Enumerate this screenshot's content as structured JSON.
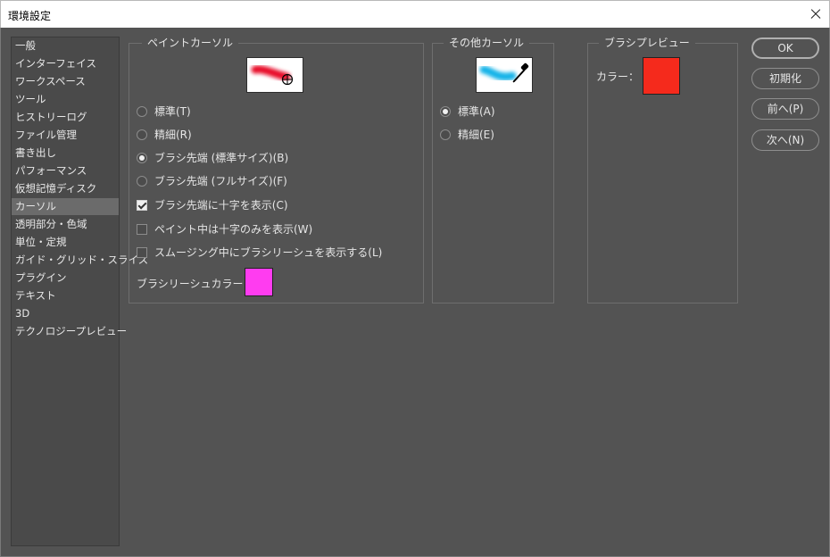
{
  "window": {
    "title": "環境設定"
  },
  "sidebar": {
    "items": [
      {
        "label": "一般",
        "selected": false
      },
      {
        "label": "インターフェイス",
        "selected": false
      },
      {
        "label": "ワークスペース",
        "selected": false
      },
      {
        "label": "ツール",
        "selected": false
      },
      {
        "label": "ヒストリーログ",
        "selected": false
      },
      {
        "label": "ファイル管理",
        "selected": false
      },
      {
        "label": "書き出し",
        "selected": false
      },
      {
        "label": "パフォーマンス",
        "selected": false
      },
      {
        "label": "仮想記憶ディスク",
        "selected": false
      },
      {
        "label": "カーソル",
        "selected": true
      },
      {
        "label": "透明部分・色域",
        "selected": false
      },
      {
        "label": "単位・定規",
        "selected": false
      },
      {
        "label": "ガイド・グリッド・スライス",
        "selected": false
      },
      {
        "label": "プラグイン",
        "selected": false
      },
      {
        "label": "テキスト",
        "selected": false
      },
      {
        "label": "3D",
        "selected": false
      },
      {
        "label": "テクノロジープレビュー",
        "selected": false
      }
    ]
  },
  "paint_cursor": {
    "legend": "ペイントカーソル",
    "options": [
      {
        "label": "標準(T)",
        "type": "radio",
        "checked": false
      },
      {
        "label": "精細(R)",
        "type": "radio",
        "checked": false
      },
      {
        "label": "ブラシ先端 (標準サイズ)(B)",
        "type": "radio",
        "checked": true
      },
      {
        "label": "ブラシ先端 (フルサイズ)(F)",
        "type": "radio",
        "checked": false
      },
      {
        "label": "ブラシ先端に十字を表示(C)",
        "type": "check",
        "checked": true
      },
      {
        "label": "ペイント中は十字のみを表示(W)",
        "type": "check",
        "checked": false
      },
      {
        "label": "スムージング中にブラシリーシュを表示する(L)",
        "type": "check",
        "checked": false
      }
    ],
    "leash_color_label": "ブラシリーシュカラー：",
    "leash_color": "#ff3cf0",
    "preview_stroke_color": "#e8102a"
  },
  "other_cursor": {
    "legend": "その他カーソル",
    "options": [
      {
        "label": "標準(A)",
        "type": "radio",
        "checked": true
      },
      {
        "label": "精細(E)",
        "type": "radio",
        "checked": false
      }
    ],
    "preview_stroke_color": "#18b4e8"
  },
  "brush_preview": {
    "legend": "ブラシプレビュー",
    "color_label": "カラー：",
    "color": "#f52a1c"
  },
  "buttons": {
    "ok": "OK",
    "reset": "初期化",
    "prev": "前へ(P)",
    "next": "次へ(N)"
  }
}
